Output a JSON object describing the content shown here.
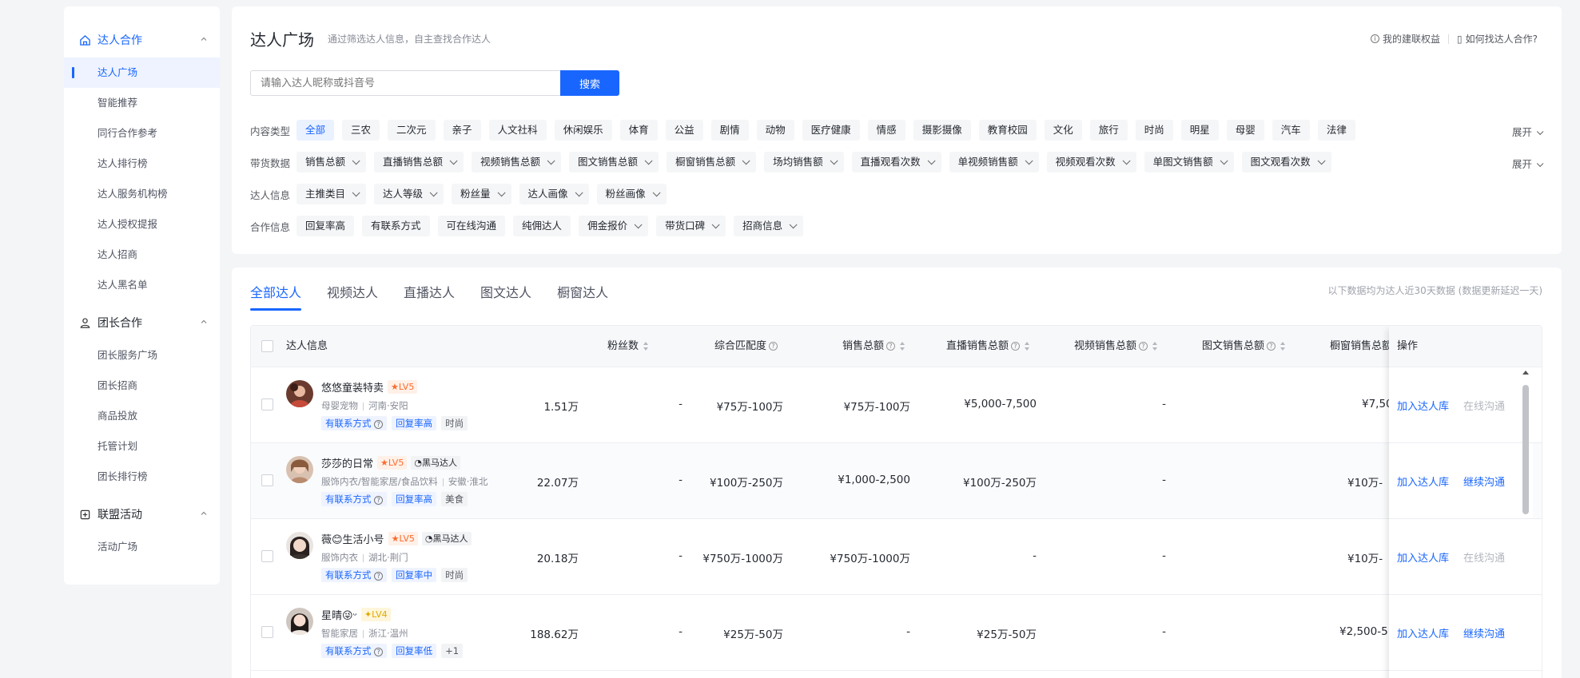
{
  "sidebar": {
    "groups": [
      {
        "title": "达人合作",
        "icon": "home-icon",
        "items": [
          "达人广场",
          "智能推荐",
          "同行合作参考",
          "达人排行榜",
          "达人服务机构榜",
          "达人授权提报",
          "达人招商",
          "达人黑名单"
        ]
      },
      {
        "title": "团长合作",
        "icon": "team-icon",
        "items": [
          "团长服务广场",
          "团长招商",
          "商品投放",
          "托管计划",
          "团长排行榜"
        ]
      },
      {
        "title": "联盟活动",
        "icon": "activity-icon",
        "items": [
          "活动广场"
        ]
      }
    ]
  },
  "header": {
    "title": "达人广场",
    "subtitle": "通过筛选达人信息，自主查找合作达人",
    "link_rights": "我的建联权益",
    "link_howto": "如何找达人合作?"
  },
  "search": {
    "placeholder": "请输入达人昵称或抖音号",
    "button": "搜索"
  },
  "filters": {
    "content_label": "内容类型",
    "content_chips": [
      "全部",
      "三农",
      "二次元",
      "亲子",
      "人文社科",
      "休闲娱乐",
      "体育",
      "公益",
      "剧情",
      "动物",
      "医疗健康",
      "情感",
      "摄影摄像",
      "教育校园",
      "文化",
      "旅行",
      "时尚",
      "明星",
      "母婴",
      "汽车",
      "法律"
    ],
    "sales_label": "带货数据",
    "sales_chips": [
      "销售总额",
      "直播销售总额",
      "视频销售总额",
      "图文销售总额",
      "橱窗销售总额",
      "场均销售额",
      "直播观看次数",
      "单视频销售额",
      "视频观看次数",
      "单图文销售额",
      "图文观看次数"
    ],
    "info_label": "达人信息",
    "info_chips": [
      "主推类目",
      "达人等级",
      "粉丝量",
      "达人画像",
      "粉丝画像"
    ],
    "coop_label": "合作信息",
    "coop_chips_plain": [
      "回复率高",
      "有联系方式",
      "可在线沟通",
      "纯佣达人"
    ],
    "coop_chips_dd": [
      "佣金报价",
      "带货口碑",
      "招商信息"
    ],
    "expand": "展开"
  },
  "tabs": [
    "全部达人",
    "视频达人",
    "直播达人",
    "图文达人",
    "橱窗达人"
  ],
  "data_note": "以下数据均为达人近30天数据 (数据更新延迟一天)",
  "table": {
    "headers": {
      "info": "达人信息",
      "fans": "粉丝数",
      "match": "综合匹配度",
      "total": "销售总额",
      "live": "直播销售总额",
      "video": "视频销售总额",
      "text": "图文销售总额",
      "window": "橱窗销售总额",
      "ops": "操作"
    },
    "rows": [
      {
        "name": "悠悠童装特卖",
        "level": "LV5",
        "badge": "",
        "category": "母婴宠物",
        "region": "河南·安阳",
        "tags": [
          "有联系方式",
          "回复率高",
          "时尚"
        ],
        "fans": "1.51万",
        "match": "-",
        "total": "¥75万-100万",
        "live": "¥75万-100万",
        "video": "¥5,000-7,500",
        "text": "-",
        "window": "¥7,500",
        "add": "加入达人库",
        "chat": "在线沟通"
      },
      {
        "name": "莎莎的日常",
        "level": "LV5",
        "badge": "黑马达人",
        "category": "服饰内衣/智能家居/食品饮料",
        "region": "安徽·淮北",
        "tags": [
          "有联系方式",
          "回复率高",
          "美食"
        ],
        "fans": "22.07万",
        "match": "-",
        "total": "¥100万-250万",
        "live": "¥1,000-2,500",
        "video": "¥100万-250万",
        "text": "-",
        "window": "¥10万-",
        "add": "加入达人库",
        "chat": "继续沟通"
      },
      {
        "name": "薇😊生活小号",
        "level": "LV5",
        "badge": "黑马达人",
        "category": "服饰内衣",
        "region": "湖北·荆门",
        "tags": [
          "有联系方式",
          "回复率中",
          "时尚"
        ],
        "fans": "20.18万",
        "match": "-",
        "total": "¥750万-1000万",
        "live": "¥750万-1000万",
        "video": "-",
        "text": "-",
        "window": "¥10万-",
        "add": "加入达人库",
        "chat": "在线沟通"
      },
      {
        "name": "星晴😜ᵕ",
        "level": "LV4",
        "badge": "",
        "category": "智能家居",
        "region": "浙江·温州",
        "tags": [
          "有联系方式",
          "回复率低",
          "+1"
        ],
        "fans": "188.62万",
        "match": "-",
        "total": "¥25万-50万",
        "live": "-",
        "video": "¥25万-50万",
        "text": "-",
        "window": "¥2,500-5",
        "add": "加入达人库",
        "chat": "继续沟通"
      }
    ]
  },
  "colors": {
    "accent": "#1966ff",
    "level_orange": "#ff6a2c",
    "level_gold": "#e0a800"
  }
}
